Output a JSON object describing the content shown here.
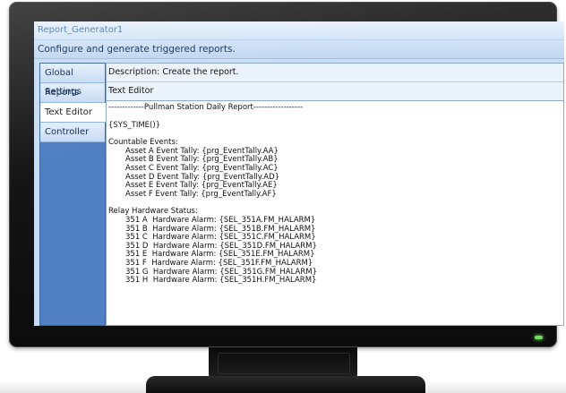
{
  "app": {
    "title": "Report_Generator1",
    "subtitle": "Configure and generate triggered reports."
  },
  "tabs": [
    {
      "label": "Global Settings",
      "active": false
    },
    {
      "label": "Reports",
      "active": false
    },
    {
      "label": "Text Editor",
      "active": true
    },
    {
      "label": "Controller",
      "active": false
    }
  ],
  "panel": {
    "description": "Description: Create the report.",
    "section_label": "Text Editor"
  },
  "editor": {
    "header_line": "-------------Pullman Station Daily Report------------------",
    "time_line": "{SYS_TIME()}",
    "countable_title": "Countable Events:",
    "countable": [
      "Asset A Event Tally: {prg_EventTally.AA}",
      "Asset B Event Tally: {prg_EventTally.AB}",
      "Asset C Event Tally: {prg_EventTally.AC}",
      "Asset D Event Tally: {prg_EventTally.AD}",
      "Asset E Event Tally: {prg_EventTally.AE}",
      "Asset F Event Tally: {prg_EventTally.AF}"
    ],
    "relay_title": "Relay Hardware Status:",
    "relay": [
      "351 A  Hardware Alarm: {SEL_351A.FM_HALARM}",
      "351 B  Hardware Alarm: {SEL_351B.FM_HALARM}",
      "351 C  Hardware Alarm: {SEL_351C.FM_HALARM}",
      "351 D  Hardware Alarm: {SEL_351D.FM_HALARM}",
      "351 E  Hardware Alarm: {SEL_351E.FM_HALARM}",
      "351 F  Hardware Alarm: {SEL_351F.FM_HALARM}",
      "351 G  Hardware Alarm: {SEL_351G.FM_HALARM}",
      "351 H  Hardware Alarm: {SEL_351H.FM_HALARM}"
    ]
  },
  "colors": {
    "tab_strip": "#4f7fc2",
    "title_text": "#4b7fbf",
    "power_led": "#6ee05a"
  }
}
